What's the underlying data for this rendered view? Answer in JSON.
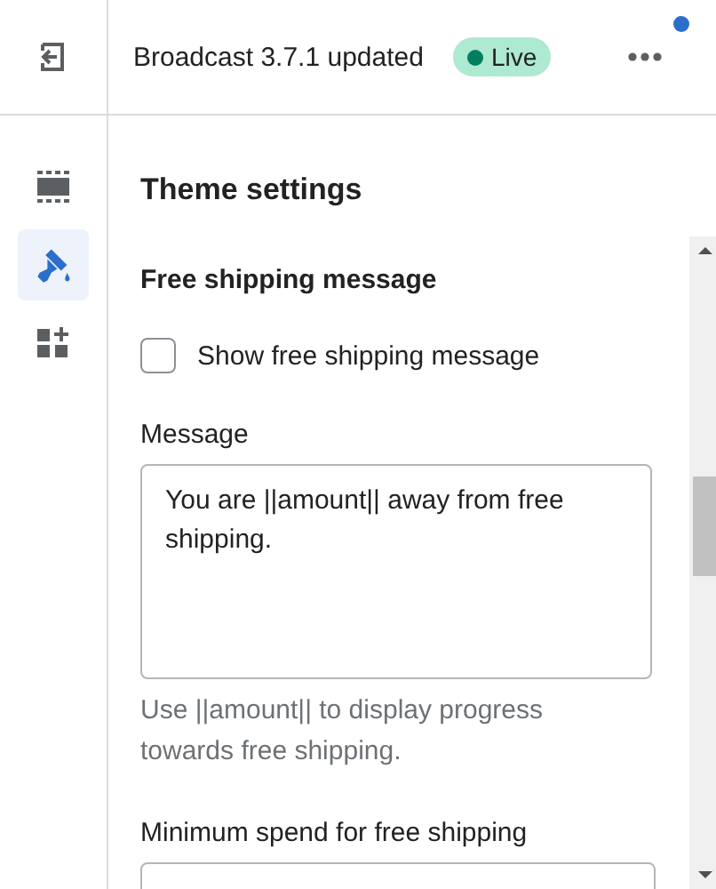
{
  "top_bar": {
    "theme_name": "Broadcast 3.7.1 updated",
    "status_badge": "Live",
    "notification": true
  },
  "sidebar": {
    "items": [
      {
        "kind": "sections",
        "selected": false
      },
      {
        "kind": "theme",
        "selected": true
      },
      {
        "kind": "apps",
        "selected": false
      }
    ]
  },
  "panel": {
    "title": "Theme settings",
    "section": {
      "heading": "Free shipping message",
      "checkbox": {
        "label": "Show free shipping message",
        "checked": false
      },
      "message": {
        "label": "Message",
        "value": "You are ||amount|| away from free shipping.",
        "help": "Use ||amount|| to display progress towards free shipping."
      },
      "minimum": {
        "label": "Minimum spend for free shipping"
      }
    }
  }
}
